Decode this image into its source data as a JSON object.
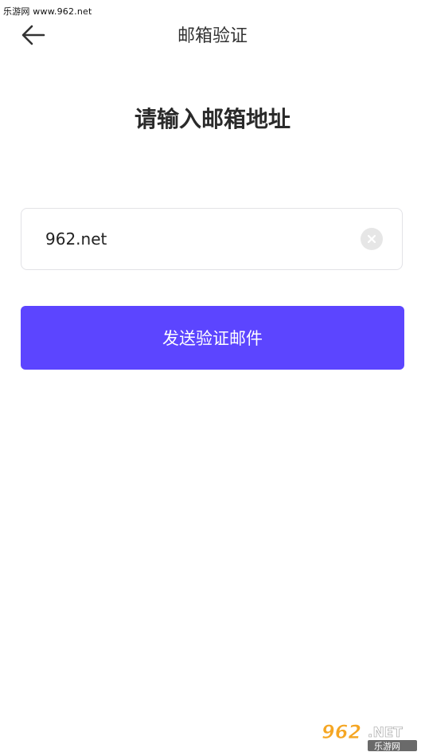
{
  "watermark": {
    "site_text": "乐游网 www.962.net",
    "logo_main": "962.NET",
    "logo_sub": "乐游网"
  },
  "nav": {
    "back_icon": "arrow-left-icon",
    "title": "邮箱验证"
  },
  "main": {
    "heading": "请输入邮箱地址",
    "email_input": {
      "value": "962.net",
      "clear_icon": "close-circle-icon"
    },
    "send_button_label": "发送验证邮件"
  },
  "colors": {
    "accent": "#5c45ff",
    "input_border": "#e2e2e6",
    "clear_bg": "#e6e6e6",
    "text_dark": "#2a2a2a",
    "logo_orange": "#f5a623"
  }
}
